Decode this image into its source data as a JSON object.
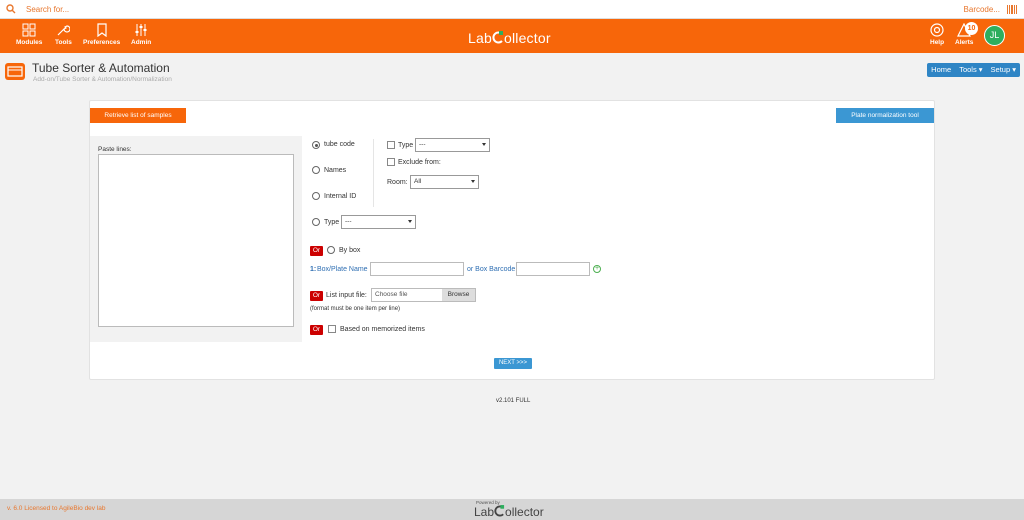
{
  "search": {
    "placeholder": "Search for...",
    "barcode_label": "Barcode..."
  },
  "topnav": {
    "modules": "Modules",
    "tools": "Tools",
    "preferences": "Preferences",
    "admin": "Admin",
    "logo_pre": "Lab",
    "logo_post": "ollector",
    "help": "Help",
    "alerts": "Alerts",
    "alerts_count": "10",
    "avatar_initials": "JL"
  },
  "page": {
    "title": "Tube Sorter & Automation",
    "breadcrumb": "Add-on/Tube Sorter & Automation/Normalization",
    "nav": {
      "home": "Home",
      "tools": "Tools ▾",
      "setup": "Setup ▾"
    }
  },
  "form": {
    "retrieve_label": "Retrieve list of samples",
    "plate_tool_label": "Plate normalization tool",
    "paste_label": "Paste lines:",
    "radio_tube_code": "tube code",
    "radio_names": "Names",
    "radio_internal_id": "Internal ID",
    "radio_type": "Type",
    "type_chk_label": "Type",
    "type_select_value": "---",
    "exclude_label": "Exclude from:",
    "room_label": "Room:",
    "room_select_value": "All",
    "type2_select_value": "---",
    "or_label": "Or",
    "by_box_label": "By box",
    "box_index": "1:",
    "box_plate_name_label": "Box/Plate Name",
    "or_box_barcode_label": "or Box Barcode",
    "list_input_file_label": "List input file:",
    "choose_file_label": "Choose file",
    "browse_label": "Browse",
    "file_note": "(format must be one item per line)",
    "memorized_label": "Based on memorized items",
    "next_label": "NEXT >>>"
  },
  "version": "v2.101 FULL",
  "footer": {
    "license": "v. 6.0 Licensed to AgileBio dev lab",
    "powered_by": "Powered by",
    "logo_pre": "Lab",
    "logo_post": "ollector"
  },
  "colors": {
    "brand_orange": "#f7660a",
    "accent_blue": "#3b97d3",
    "avatar_green": "#2eae5e",
    "or_red": "#cc0000"
  }
}
